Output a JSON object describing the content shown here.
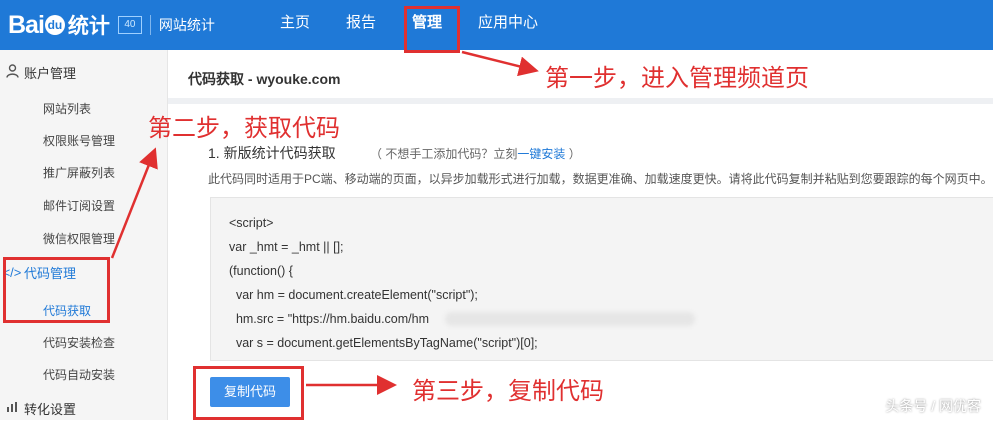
{
  "header": {
    "brand": "Bai",
    "brand_du": "du",
    "brand_suffix": "统计",
    "version_badge": "40",
    "site_label": "网站统计",
    "nav": [
      "主页",
      "报告",
      "管理",
      "应用中心"
    ]
  },
  "sidebar": {
    "account_group": "账户管理",
    "account_items": [
      "网站列表",
      "权限账号管理",
      "推广屏蔽列表",
      "邮件订阅设置",
      "微信权限管理"
    ],
    "code_group": "代码管理",
    "code_items": [
      "代码获取",
      "代码安装检查",
      "代码自动安装"
    ],
    "convert_group": "转化设置"
  },
  "main": {
    "title": "代码获取 - wyouke.com",
    "section_title": "1. 新版统计代码获取",
    "hint_prefix": "（ 不想手工添加代码？立刻",
    "hint_link": "一键安装",
    "hint_suffix": " ）",
    "description": "此代码同时适用于PC端、移动端的页面，以异步加载形式进行加载，数据更准确、加载速度更快。请将此代码复制并粘贴到您要跟踪的每个网页中。",
    "code_lines": [
      "<script>",
      "var _hmt = _hmt || [];",
      "(function() {",
      "  var hm = document.createElement(\"script\");",
      "  hm.src = \"https://hm.baidu.com/hm",
      "  var s = document.getElementsByTagName(\"script\")[0];"
    ],
    "copy_button": "复制代码"
  },
  "annotations": {
    "step1": "第一步，进入管理频道页",
    "step2": "第二步，获取代码",
    "step3": "第三步，复制代码",
    "color": "#e03030"
  },
  "watermark": "头条号 / 网优客"
}
